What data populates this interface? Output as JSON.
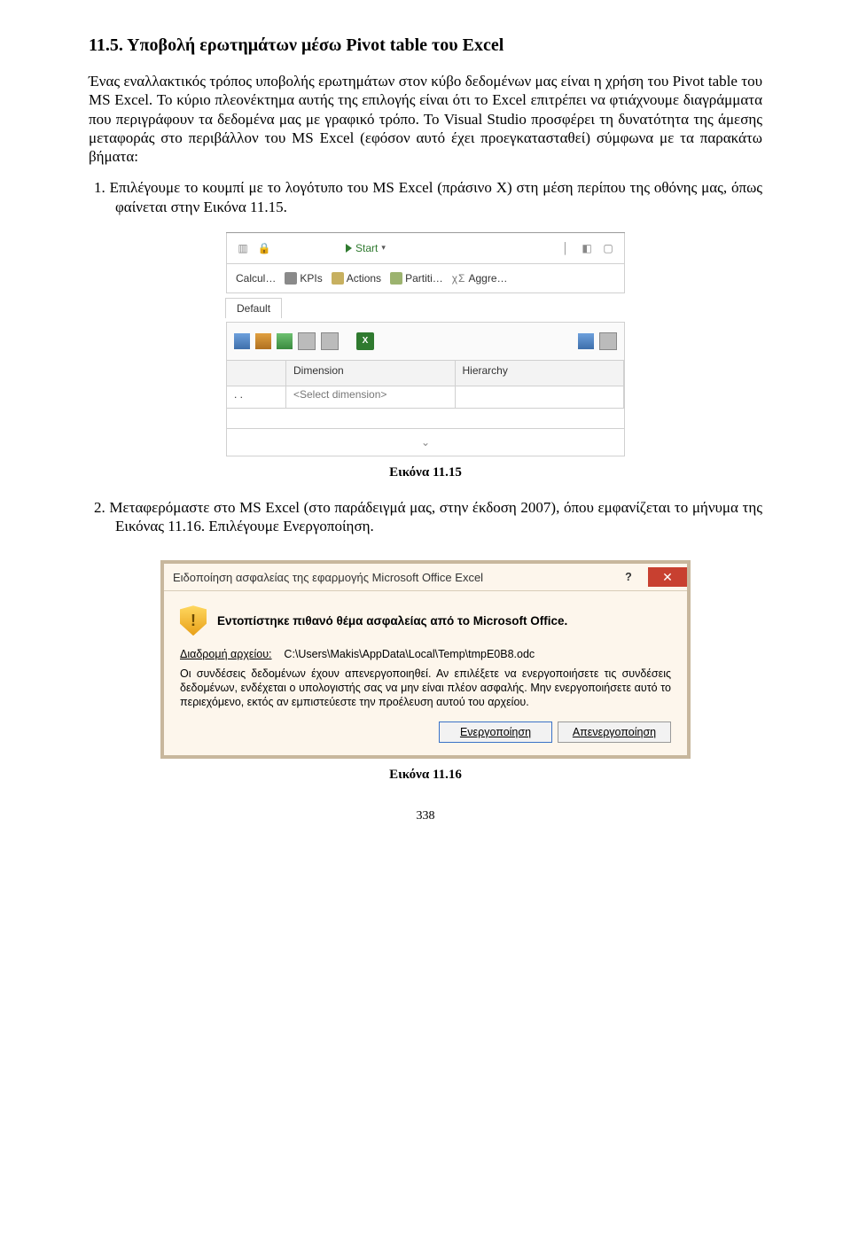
{
  "section_heading": "11.5. Υποβολή ερωτημάτων μέσω Pivot table του Excel",
  "paragraph_intro": "Ένας εναλλακτικός τρόπος υποβολής ερωτημάτων στον κύβο δεδομένων μας είναι η χρήση του Pivot table του MS Excel. Το κύριο πλεονέκτημα αυτής της επιλογής είναι ότι το Excel επιτρέπει να φτιάχνουμε διαγράμματα που περιγράφουν τα δεδομένα μας με γραφικό τρόπο. Το Visual Studio προσφέρει τη δυνατότητα της άμεσης μεταφοράς στο περιβάλλον του MS Excel (εφόσον αυτό έχει προεγκατασταθεί) σύμφωνα με τα παρακάτω βήματα:",
  "list_item_1_num": "1.",
  "list_item_1": "Επιλέγουμε το κουμπί με το λογότυπο του MS Excel (πράσινο Χ) στη μέση περίπου της οθόνης μας, όπως φαίνεται στην Εικόνα 11.15.",
  "fig1": {
    "start_label": "Start",
    "tabs": {
      "calcul": "Calcul…",
      "kpis": "KPIs",
      "actions": "Actions",
      "partiti": "Partiti…",
      "aggre": "Aggre…"
    },
    "default_tab": "Default",
    "excel_glyph": "X",
    "col_dimension": "Dimension",
    "col_hierarchy": "Hierarchy",
    "select_dimension": "<Select dimension>",
    "dots": ". .",
    "chev": "⌄"
  },
  "caption_1": "Εικόνα 11.15",
  "list_item_2_num": "2.",
  "list_item_2": "Μεταφερόμαστε στο MS Excel (στο παράδειγμά μας, στην έκδοση 2007), όπου εμφανίζεται το μήνυμα της Εικόνας 11.16. Επιλέγουμε Ενεργοποίηση.",
  "fig2": {
    "title": "Ειδοποίηση ασφαλείας της εφαρμογής Microsoft Office Excel",
    "help": "?",
    "close": "✕",
    "shield_glyph": "!",
    "heading": "Εντοπίστηκε πιθανό θέμα ασφαλείας από το Microsoft Office.",
    "path_label": "Διαδρομή αρχείου:",
    "path_value": "C:\\Users\\Makis\\AppData\\Local\\Temp\\tmpE0B8.odc",
    "msg": "Οι συνδέσεις δεδομένων έχουν απενεργοποιηθεί. Αν επιλέξετε να ενεργοποιήσετε τις συνδέσεις δεδομένων, ενδέχεται ο υπολογιστής σας να μην είναι πλέον ασφαλής. Μην ενεργοποιήσετε αυτό το περιεχόμενο, εκτός αν εμπιστεύεστε την προέλευση αυτού του αρχείου.",
    "btn_enable": "Ενεργοποίηση",
    "btn_disable": "Απενεργοποίηση"
  },
  "caption_2": "Εικόνα 11.16",
  "page_number": "338"
}
